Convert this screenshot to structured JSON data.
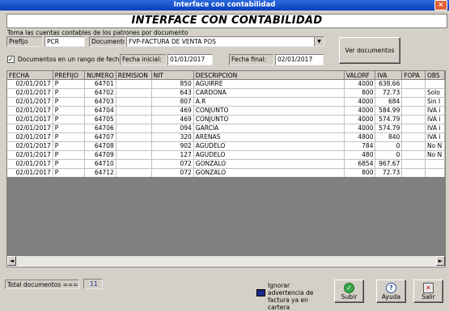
{
  "window": {
    "title": "Interface con contabilidad",
    "close_glyph": "×"
  },
  "banner": "INTERFACE  CON  CONTABILIDAD",
  "instruction": "Toma las cuentas contables de los patrones por documento",
  "filters": {
    "prefijo_label": "Prefijo",
    "prefijo_value": "PCR",
    "documento_label": "Documento",
    "documento_value": "FVP-FACTURA DE VENTA POS",
    "range_checkbox_label": "Documentos en un rango de fechas",
    "range_checked": true,
    "fecha_inicial_label": "Fecha inicial:",
    "fecha_inicial_value": "01/01/2017",
    "fecha_final_label": "Fecha final:",
    "fecha_final_value": "02/01/2017",
    "ver_documentos_label": "Ver documentos"
  },
  "table": {
    "columns": [
      "FECHA",
      "PREFIJO",
      "NUMERO",
      "REMISION",
      "NIT",
      "DESCRIPCION",
      "VALORF",
      "IVA",
      "FOPA",
      "OBS"
    ],
    "rows": [
      [
        "02/01/2017",
        "P",
        "64701",
        "",
        "850",
        "AGUIRRE",
        "4000",
        "638.66",
        "",
        ""
      ],
      [
        "02/01/2017",
        "P",
        "64702",
        "",
        "643",
        "CARDONA",
        "800",
        "72.73",
        "",
        "Solo"
      ],
      [
        "02/01/2017",
        "P",
        "64703",
        "",
        "807",
        "A.R",
        "4000",
        "684",
        "",
        "Sin I"
      ],
      [
        "02/01/2017",
        "P",
        "64704",
        "",
        "469",
        "CONJUNTO",
        "4000",
        "584.99",
        "",
        "IVA i"
      ],
      [
        "02/01/2017",
        "P",
        "64705",
        "",
        "469",
        "CONJUNTO",
        "4000",
        "574.79",
        "",
        "IVA i"
      ],
      [
        "02/01/2017",
        "P",
        "64706",
        "",
        "094",
        "GARCIA",
        "4000",
        "574.79",
        "",
        "IVA i"
      ],
      [
        "02/01/2017",
        "P",
        "64707",
        "",
        "320",
        "ARENAS",
        "4800",
        "840",
        "",
        "IVA i"
      ],
      [
        "02/01/2017",
        "P",
        "64708",
        "",
        "902",
        "AGUDELO",
        "784",
        "0",
        "",
        "No N"
      ],
      [
        "02/01/2017",
        "P",
        "64709",
        "",
        "127",
        "AGUDELO",
        "480",
        "0",
        "",
        "No N"
      ],
      [
        "02/01/2017",
        "P",
        "64710",
        "",
        "072",
        "GONZALO",
        "6854",
        "967.67",
        "",
        ""
      ],
      [
        "02/01/2017",
        "P",
        "64712",
        "",
        "072",
        "GONZALO",
        "800",
        "72.73",
        "",
        ""
      ]
    ]
  },
  "footer": {
    "total_label": "Total documentos ===>",
    "total_value": "11",
    "ignore_label": "Ignorar advertencia de factura ya en cartera",
    "ignore_checked": false,
    "subir_label": "Subir",
    "ayuda_label": "Ayuda",
    "salir_label": "Salir"
  },
  "colors": {
    "titlebar": "#0a3fb8",
    "window_bg": "#d4d0c8",
    "grid_empty": "#808080"
  }
}
